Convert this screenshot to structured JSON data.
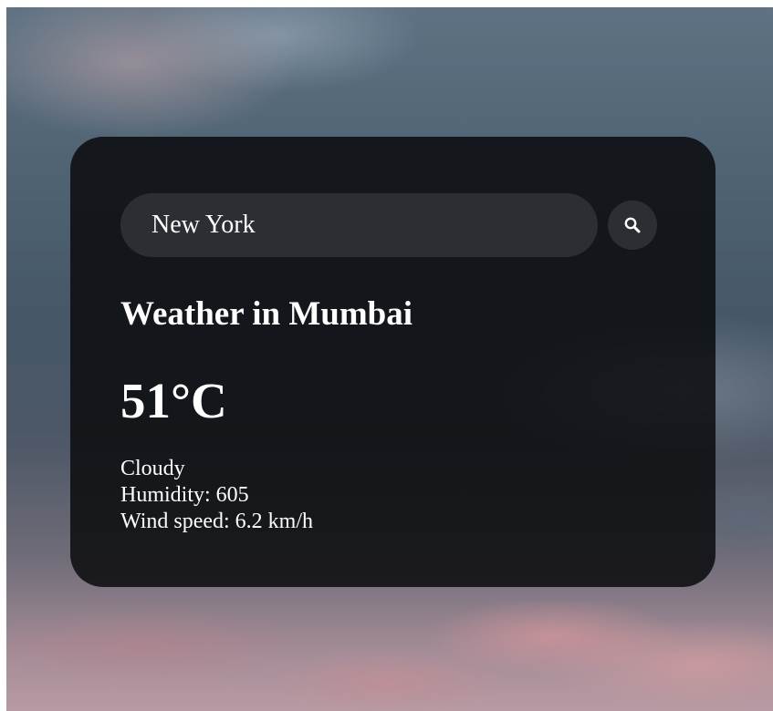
{
  "search": {
    "value": "New York",
    "button_icon": "search-icon"
  },
  "weather": {
    "title": "Weather in Mumbai",
    "temperature": "51°C",
    "description": "Cloudy",
    "humidity": "Humidity: 605",
    "wind": "Wind speed: 6.2 km/h"
  },
  "colors": {
    "card": "#0a0c0e",
    "text": "#ffffff"
  }
}
